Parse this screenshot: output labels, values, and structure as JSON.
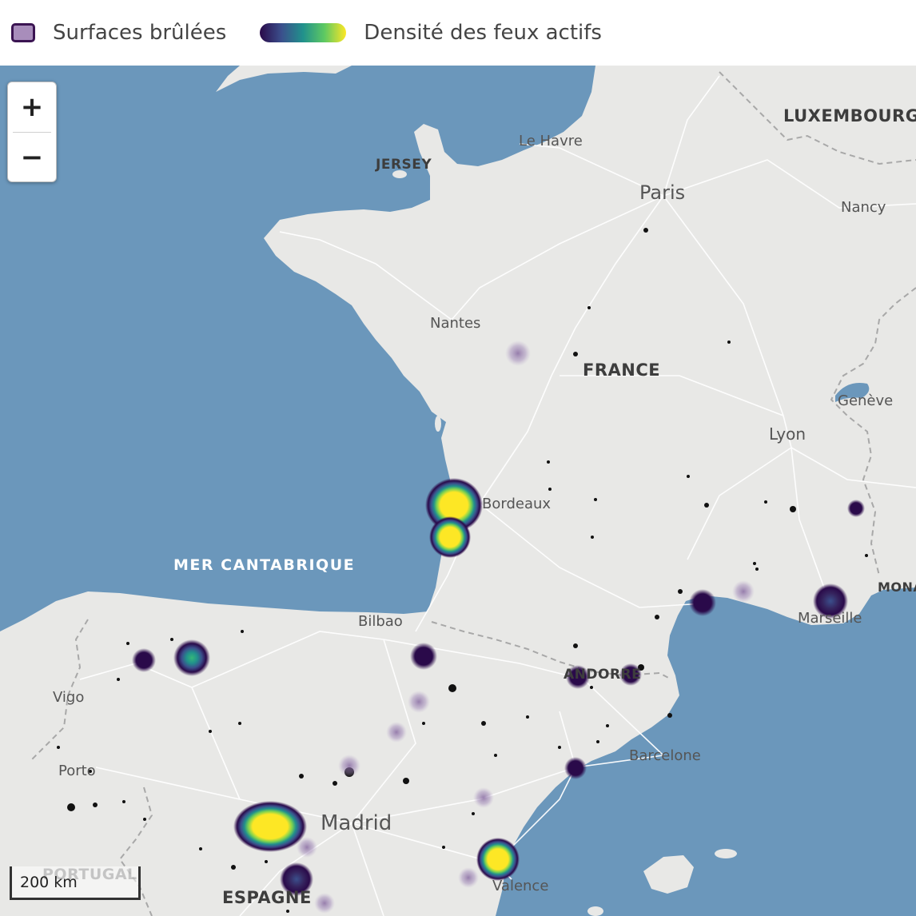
{
  "legend": {
    "burned_label": "Surfaces brûlées",
    "density_label": "Densité des feux actifs",
    "burned_color": "#a88dbb",
    "density_gradient": [
      "#2a0a4a",
      "#3b4f8c",
      "#21918c",
      "#5ec962",
      "#fde725"
    ]
  },
  "zoom": {
    "in_label": "+",
    "out_label": "−"
  },
  "scale": {
    "label": "200 km"
  },
  "labels": {
    "luxembourg": "LUXEMBOURG",
    "le_havre": "Le Havre",
    "jersey": "JERSEY",
    "paris": "Paris",
    "nancy": "Nancy",
    "nantes": "Nantes",
    "france": "FRANCE",
    "geneve": "Genève",
    "lyon": "Lyon",
    "bordeaux": "Bordeaux",
    "mer_cantabrique": "MER CANTABRIQUE",
    "monaco": "MONAC",
    "marseille": "Marseille",
    "bilbao": "Bilbao",
    "andorre": "ANDORRE",
    "vigo": "Vigo",
    "barcelone": "Barcelone",
    "porto": "Porto",
    "madrid": "Madrid",
    "portugal": "PORTUGAL",
    "espagne": "ESPAGNE",
    "valence": "Valence"
  },
  "colors": {
    "sea": "#6b97bb",
    "land": "#e8e8e6",
    "road": "#ffffff",
    "border": "#a8a8a8",
    "burn_scar": "#111111"
  }
}
